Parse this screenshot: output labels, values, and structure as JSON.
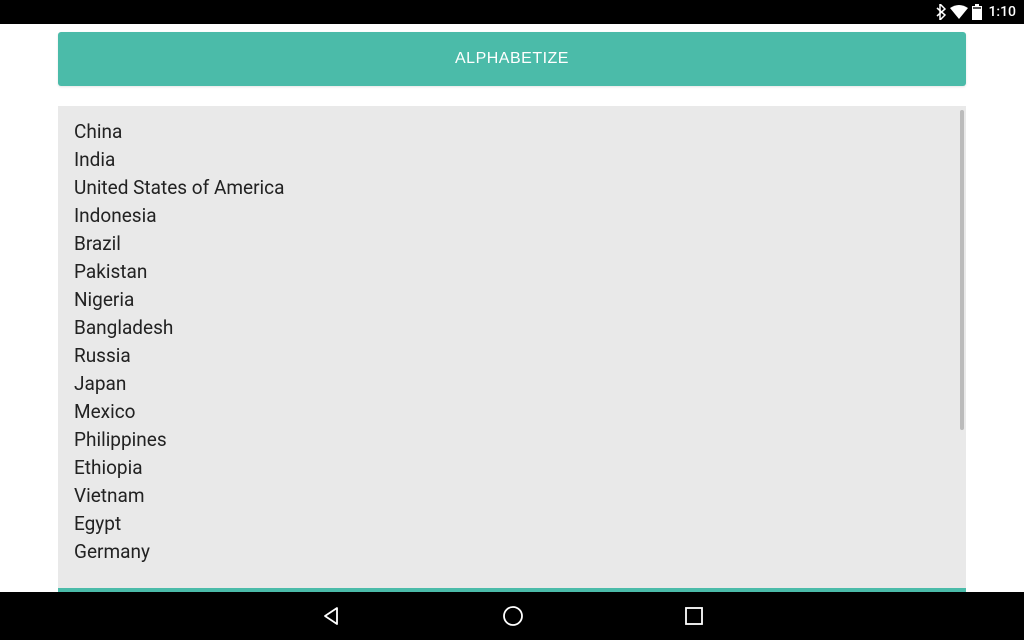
{
  "statusBar": {
    "time": "1:10"
  },
  "main": {
    "buttonLabel": "ALPHABETIZE",
    "textareaContent": "China\nIndia\nUnited States of America\nIndonesia\nBrazil\nPakistan\nNigeria\nBangladesh\nRussia\nJapan\nMexico\nPhilippines\nEthiopia\nVietnam\nEgypt\nGermany"
  }
}
